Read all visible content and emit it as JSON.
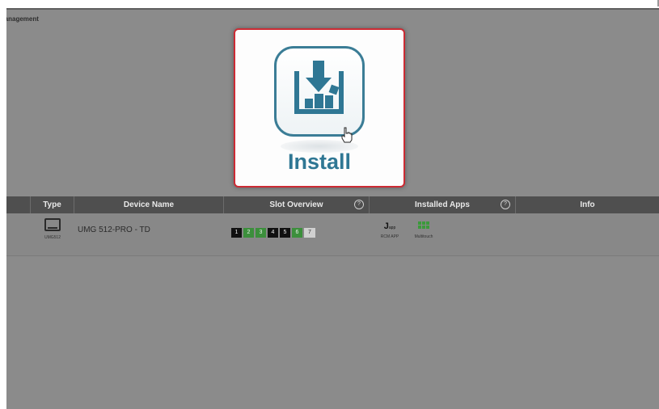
{
  "app": {
    "title": "Management"
  },
  "install": {
    "label": "Install",
    "icon": "install-icon"
  },
  "table": {
    "headers": {
      "type": "Type",
      "device_name": "Device Name",
      "slot_overview": "Slot Overview",
      "installed_apps": "Installed Apps",
      "info": "Info",
      "help_glyph": "?"
    },
    "rows": [
      {
        "type_icon": "device-icon",
        "type_label": "UMG512",
        "device_name": "UMG 512-PRO - TD",
        "slots": [
          {
            "label": "1",
            "state": "black"
          },
          {
            "label": "2",
            "state": "green"
          },
          {
            "label": "3",
            "state": "green"
          },
          {
            "label": "4",
            "state": "black"
          },
          {
            "label": "5",
            "state": "black"
          },
          {
            "label": "6",
            "state": "green"
          },
          {
            "label": "7",
            "state": "empty"
          }
        ],
        "apps": [
          {
            "glyph": "J",
            "sub": "app",
            "label": "RCM APP",
            "icon": "jasic-icon"
          },
          {
            "label": "Multitouch",
            "icon": "multitouch-grid-icon"
          }
        ],
        "info": ""
      }
    ]
  },
  "colors": {
    "overlay": "#8b8b8b",
    "header": "#4f4f4f",
    "accent_border": "#cc2b34",
    "install_blue": "#2f7794",
    "slot_green": "#3c8f3c"
  }
}
